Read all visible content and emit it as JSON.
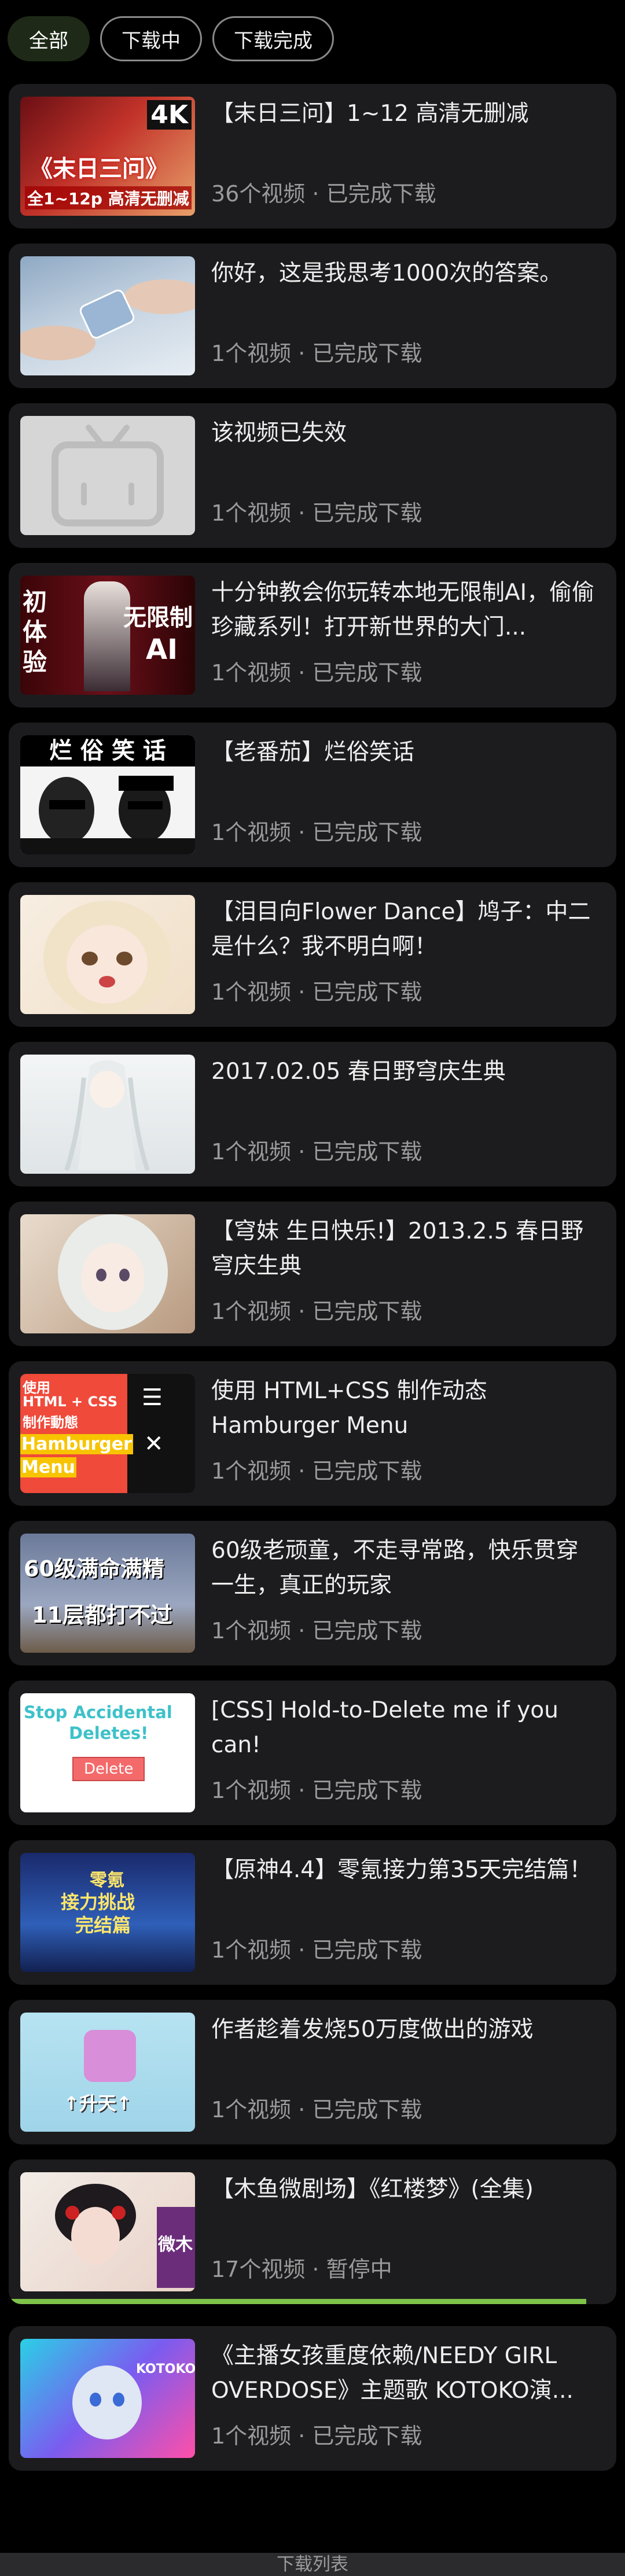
{
  "tabs": [
    {
      "label": "全部",
      "active": true
    },
    {
      "label": "下载中",
      "active": false
    },
    {
      "label": "下载完成",
      "active": false
    }
  ],
  "items": [
    {
      "title": "【末日三问】1~12 高清无删减",
      "meta": "36个视频 · 已完成下载",
      "thumb": {
        "line1": "《末日三问》",
        "line2": "全1~12p 高清无删减",
        "badge": "4K"
      }
    },
    {
      "title": "你好，这是我思考1000次的答案。",
      "meta": "1个视频 · 已完成下载"
    },
    {
      "title": "该视频已失效",
      "meta": "1个视频 · 已完成下载"
    },
    {
      "title": "十分钟教会你玩转本地无限制AI，偷偷珍藏系列！打开新世界的大门...",
      "meta": "1个视频 · 已完成下载",
      "thumb": {
        "left": "初体验",
        "right": "无限制",
        "right2": "AI"
      }
    },
    {
      "title": "【老番茄】烂俗笑话",
      "meta": "1个视频 · 已完成下载",
      "thumb": {
        "banner": "烂 俗 笑 话"
      }
    },
    {
      "title": "【泪目向Flower Dance】鸠子：中二是什么？我不明白啊！",
      "meta": "1个视频 · 已完成下载"
    },
    {
      "title": "2017.02.05 春日野穹庆生典",
      "meta": "1个视频 · 已完成下载"
    },
    {
      "title": "【穹妹 生日快乐!】2013.2.5 春日野穹庆生典",
      "meta": "1个视频 · 已完成下载"
    },
    {
      "title": "使用 HTML+CSS 制作动态 Hamburger Menu",
      "meta": "1个视频 · 已完成下载",
      "thumb": {
        "l1": "使用",
        "l2": "HTML + CSS",
        "l3": "制作動態",
        "l4": "Hamburger",
        "l5": "Menu"
      }
    },
    {
      "title": "60级老顽童，不走寻常路，快乐贯穿一生，真正的玩家",
      "meta": "1个视频 · 已完成下载",
      "thumb": {
        "l1": "60级满命满精",
        "l2": "11层都打不过"
      }
    },
    {
      "title": "[CSS] Hold-to-Delete me if you can!",
      "meta": "1个视频 · 已完成下载",
      "thumb": {
        "l1": "Stop Accidental",
        "l2": "Deletes!",
        "btn": "Delete"
      }
    },
    {
      "title": "【原神4.4】零氪接力第35天完结篇！",
      "meta": "1个视频 · 已完成下载",
      "thumb": {
        "l1": "零氪",
        "l2": "接力挑战",
        "l3": "完结篇"
      }
    },
    {
      "title": "作者趁着发烧50万度做出的游戏",
      "meta": "1个视频 · 已完成下载",
      "thumb": {
        "l1": "↑升天↑"
      }
    },
    {
      "title": "【木鱼微剧场】《红楼梦》(全集)",
      "meta": "17个视频 · 暂停中",
      "progress": 0.95,
      "thumb": {
        "l1": "微木"
      }
    },
    {
      "title": "《主播女孩重度依赖/NEEDY GIRL OVERDOSE》主题歌 KOTOKO演...",
      "meta": "1个视频 · 已完成下载",
      "thumb": {
        "l1": "KOTOKO"
      }
    }
  ],
  "footer": "下载列表",
  "colors": {
    "accent": "#7ec24a",
    "card": "#1c1c1e",
    "active_tab": "#1e2a17"
  }
}
